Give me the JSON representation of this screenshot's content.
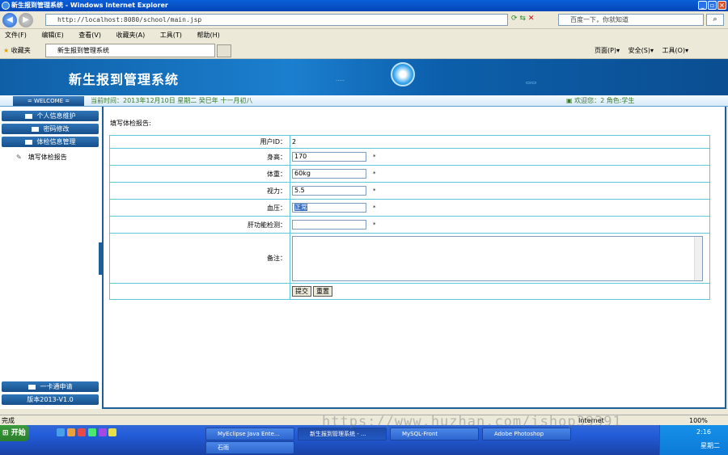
{
  "window": {
    "title": "新生报到管理系统 - Windows Internet Explorer"
  },
  "browser": {
    "address": "http://localhost:8080/school/main.jsp",
    "search_placeholder": "百度一下，你就知道",
    "menu": [
      "文件(F)",
      "编辑(E)",
      "查看(V)",
      "收藏夹(A)",
      "工具(T)",
      "帮助(H)"
    ],
    "favorites_label": "收藏夹",
    "tab_title": "新生报到管理系统",
    "toolbar_right": [
      "页面(P)",
      "安全(S)",
      "工具(O)"
    ]
  },
  "app": {
    "title": "新生报到管理系统",
    "welcome": "WELCOME",
    "current_time": "当前时间：2013年12月10日 星期二 癸巳年 十一月初八",
    "user_info": "欢迎您：2 角色:学生",
    "sidebar": {
      "items": [
        "个人信息维护",
        "密码修改",
        "体检信息管理"
      ],
      "sub_item": "填写体检报告",
      "bottom_items": [
        "一卡通申请",
        "版本2013-V1.0"
      ]
    },
    "form": {
      "heading": "填写体检报告:",
      "fields": [
        {
          "label": "用户ID：",
          "value": "2"
        },
        {
          "label": "身高：",
          "value": "170"
        },
        {
          "label": "体重：",
          "value": "60kg"
        },
        {
          "label": "视力：",
          "value": "5.5"
        },
        {
          "label": "血压：",
          "value": "正常"
        },
        {
          "label": "肝功能检测：",
          "value": ""
        },
        {
          "label": "备注：",
          "value": ""
        }
      ],
      "required_mark": "*",
      "submit_label": "提交",
      "reset_label": "重置"
    }
  },
  "statusbar": {
    "left": "完成",
    "zone": "Internet",
    "zoom": "100%"
  },
  "taskbar": {
    "start": "开始",
    "buttons": [
      "MyEclipse Java Ente...",
      "新生报到管理系统 - ...",
      "MySQL-Front",
      "Adobe Photoshop",
      "石雨"
    ],
    "clock": "2:16",
    "day": "星期二"
  },
  "watermark": "https://www.huzhan.com/ishop39391"
}
